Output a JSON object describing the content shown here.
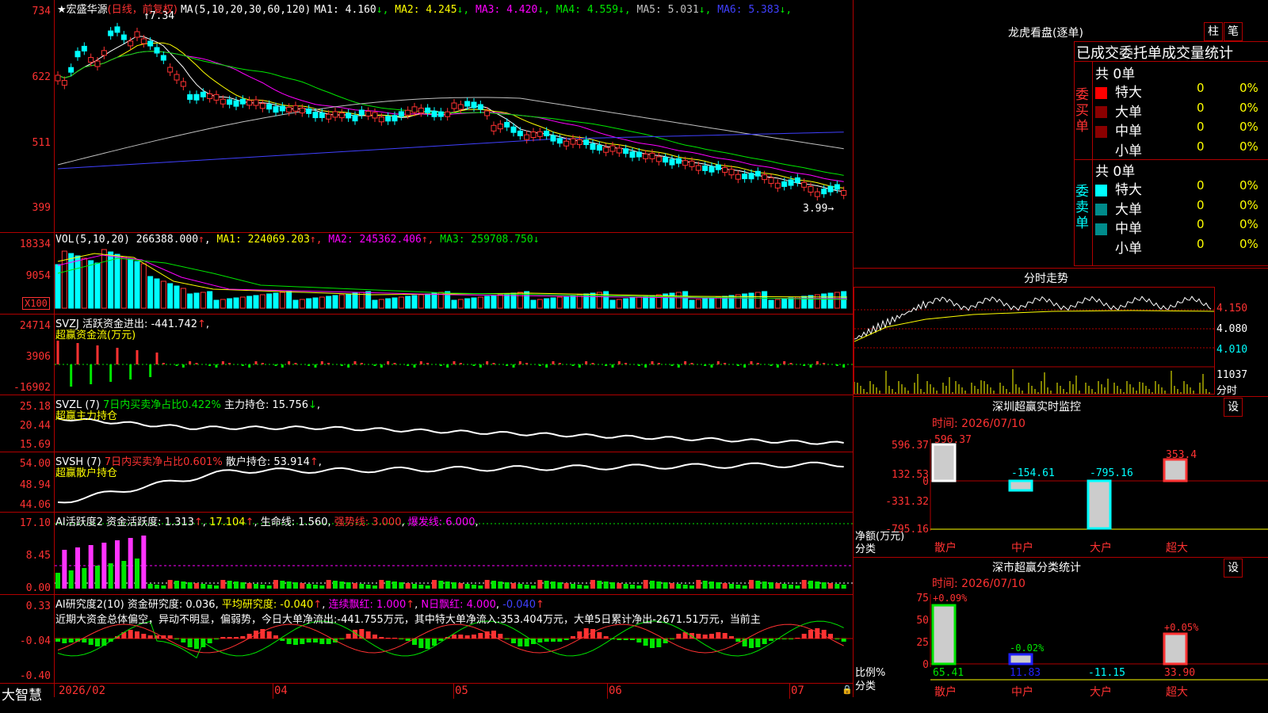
{
  "stock": {
    "name": "宏盛华源",
    "period": "(日线，前复权)",
    "ma_label": "MA(5,10,20,30,60,120)",
    "ma": [
      {
        "label": "MA1:",
        "value": "4.160",
        "color": "#ffffff"
      },
      {
        "label": "MA2:",
        "value": "4.245",
        "color": "#ffff00"
      },
      {
        "label": "MA3:",
        "value": "4.420",
        "color": "#ff00ff"
      },
      {
        "label": "MA4:",
        "value": "4.559",
        "color": "#00e600"
      },
      {
        "label": "MA5:",
        "value": "5.031",
        "color": "#c0c0c0"
      },
      {
        "label": "MA6:",
        "value": "5.383",
        "color": "#4040ff"
      }
    ],
    "high_mark": "7.34",
    "low_mark": "3.99",
    "y_labels": [
      "734",
      "622",
      "511",
      "399"
    ]
  },
  "vol": {
    "label": "VOL(5,10,20)",
    "value": "266388.000",
    "ma": [
      {
        "label": "MA1:",
        "value": "224069.203",
        "color": "#ffff00"
      },
      {
        "label": "MA2:",
        "value": "245362.406",
        "color": "#ff00ff"
      },
      {
        "label": "MA3:",
        "value": "259708.750",
        "color": "#00e600"
      }
    ],
    "y_labels": [
      "18334",
      "9054"
    ],
    "unit": "X100"
  },
  "svzj": {
    "label": "SVZJ",
    "text": "活跃资金进出:",
    "value": "-441.742",
    "sub": "超赢资金流(万元)",
    "y_labels": [
      "24714",
      "3906",
      "-16902"
    ]
  },
  "svzl": {
    "label": "SVZL (7)",
    "text1": "7日内买卖净占比0.422%",
    "text2": "主力持仓:",
    "value": "15.756",
    "sub": "超赢主力持仓",
    "y_labels": [
      "25.18",
      "20.44",
      "15.69"
    ]
  },
  "svsh": {
    "label": "SVSH (7)",
    "text1": "7日内买卖净占比0.601%",
    "text2": "散户持仓:",
    "value": "53.914",
    "sub": "超赢散户持仓",
    "y_labels": [
      "54.00",
      "48.94",
      "44.06"
    ]
  },
  "ai1": {
    "label": "AI活跃度2",
    "text": "资金活跃度:",
    "v1": "1.313",
    "v2": "17.104",
    "text3": "生命线:",
    "v3": "1.560",
    "strong": "强势线: 3.000",
    "burst": "爆发线: 6.000",
    "y_labels": [
      "17.10",
      "8.45",
      "0.00"
    ]
  },
  "ai2": {
    "label": "AI研究度2(10)",
    "text1": "资金研究度:",
    "v1": "0.036",
    "text2": "平均研究度:",
    "v2": "-0.040",
    "text3": "连续飘红:",
    "v3": "1.000",
    "text4": "N日飘红:",
    "v4": "4.000",
    "v5": "-0.040",
    "comment": "近期大资金总体偏空，异动不明显，偏弱势，今日大单净流出:-441.755万元，其中特大单净流入:353.404万元，大单5日累计净出-2671.51万元，当前主",
    "y_labels": [
      "0.33",
      "-0.04",
      "-0.40"
    ]
  },
  "xaxis": {
    "labels": [
      "2026/02",
      "04",
      "05",
      "06",
      "07"
    ],
    "brand": "大智慧"
  },
  "right": {
    "btn1": "柱",
    "btn2": "笔",
    "title": "龙虎看盘(逐单)",
    "table_header": "已成交委托单成交量统计",
    "buy_side": "委买单",
    "sell_side": "委卖单",
    "count_buy": "共 0单",
    "count_sell": "共 0单",
    "rows": [
      {
        "name": "特大",
        "val": "0",
        "pct": "0%"
      },
      {
        "name": "大单",
        "val": "0",
        "pct": "0%"
      },
      {
        "name": "中单",
        "val": "0",
        "pct": "0%"
      },
      {
        "name": "小单",
        "val": "0",
        "pct": "0%"
      }
    ],
    "colors_buy": [
      "#ff0000",
      "#8b0000",
      "#8b0000",
      "#000000"
    ],
    "colors_sell": [
      "#00ffff",
      "#008b8b",
      "#008b8b",
      "#000000"
    ],
    "intraday_title": "分时走势",
    "intraday_labels": [
      "4.150",
      "4.080",
      "4.010"
    ],
    "intraday_vol": "11037",
    "intraday_vol_label": "分时",
    "monitor_title": "深圳超赢实时监控",
    "monitor_btn": "设",
    "monitor_time": "时间: 2026/07/10",
    "monitor_y": [
      "596.37",
      "132.53",
      "0",
      "-331.32",
      "-795.16"
    ],
    "monitor_yaxis_label1": "净额(万元)",
    "monitor_yaxis_label2": "分类",
    "monitor_cats": [
      "散户",
      "中户",
      "大户",
      "超大"
    ],
    "monitor_values": [
      "596.37",
      "-154.61",
      "-795.16",
      "353.4"
    ],
    "class_title": "深市超赢分类统计",
    "class_btn": "设",
    "class_time": "时间: 2026/07/10",
    "class_y": [
      "75",
      "50",
      "25",
      "0"
    ],
    "class_yaxis_label1": "比例%",
    "class_yaxis_label2": "分类",
    "class_top": [
      "+0.09%",
      "-0.02%",
      "+0.05%"
    ],
    "class_bottom": [
      "65.41",
      "11.83",
      "-11.15",
      "33.90"
    ],
    "class_cats": [
      "散户",
      "中户",
      "大户",
      "超大"
    ]
  }
}
